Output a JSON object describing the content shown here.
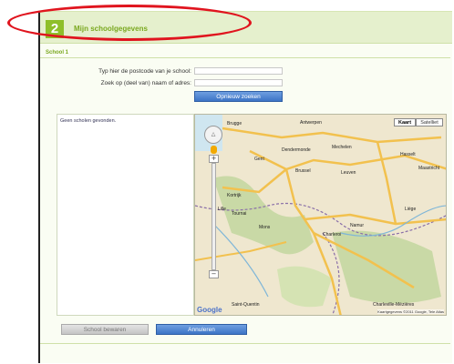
{
  "header": {
    "step_number": "2",
    "title": "Mijn schoolgegevens"
  },
  "section": {
    "label": "School 1"
  },
  "form": {
    "postcode_label": "Typ hier de postcode van je school:",
    "search_label": "Zoek op (deel van) naam of adres:",
    "search_button": "Opnieuw zoeken"
  },
  "results": {
    "empty_text": "Geen scholen gevonden."
  },
  "map": {
    "type_map": "Kaart",
    "type_satellite": "Satelliet",
    "google_logo": "Google",
    "copyright": "Kaartgegevens ©2011 Google, Tele Atlas",
    "cities": [
      "Brugge",
      "Antwerpen",
      "Gent",
      "Dendermonde",
      "Mechelen",
      "Brussel",
      "Leuven",
      "Hasselt",
      "Maastricht",
      "Kortrijk",
      "Mons",
      "Namur",
      "Liège",
      "Charleroi",
      "Tournai",
      "Lille",
      "Saint-Quentin",
      "Charleville-Mézières"
    ],
    "colors": {
      "land": "#efe7cf",
      "forest": "#c9d9a6",
      "highway": "#f2c14e",
      "border": "#8a6fa8"
    }
  },
  "actions": {
    "save_button": "School bewaren",
    "cancel_button": "Annuleren"
  }
}
